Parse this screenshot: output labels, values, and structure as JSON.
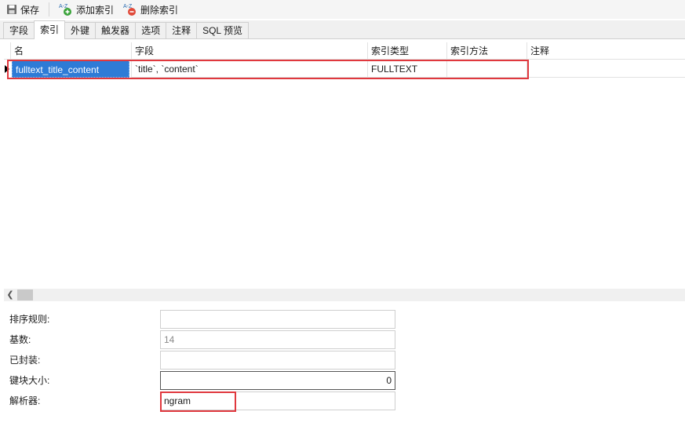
{
  "toolbar": {
    "save_label": "保存",
    "add_index_label": "添加索引",
    "delete_index_label": "删除索引",
    "az_text": "A-Z"
  },
  "tabs": [
    {
      "label": "字段"
    },
    {
      "label": "索引"
    },
    {
      "label": "外键"
    },
    {
      "label": "触发器"
    },
    {
      "label": "选项"
    },
    {
      "label": "注释"
    },
    {
      "label": "SQL 预览"
    }
  ],
  "active_tab": "索引",
  "grid": {
    "columns": [
      "名",
      "字段",
      "索引类型",
      "索引方法",
      "注释"
    ],
    "rows": [
      {
        "name": "fulltext_title_content",
        "fields": "`title`, `content`",
        "type": "FULLTEXT",
        "method": "",
        "comment": ""
      }
    ]
  },
  "properties": {
    "collation": {
      "label": "排序规则:",
      "value": ""
    },
    "cardinality": {
      "label": "基数:",
      "value": "14"
    },
    "packed": {
      "label": "已封装:",
      "value": ""
    },
    "key_block_size": {
      "label": "键块大小:",
      "value": "0"
    },
    "parser": {
      "label": "解析器:",
      "value": "ngram"
    }
  },
  "colors": {
    "highlight": "#e0383e",
    "selection": "#2e7bd6"
  }
}
